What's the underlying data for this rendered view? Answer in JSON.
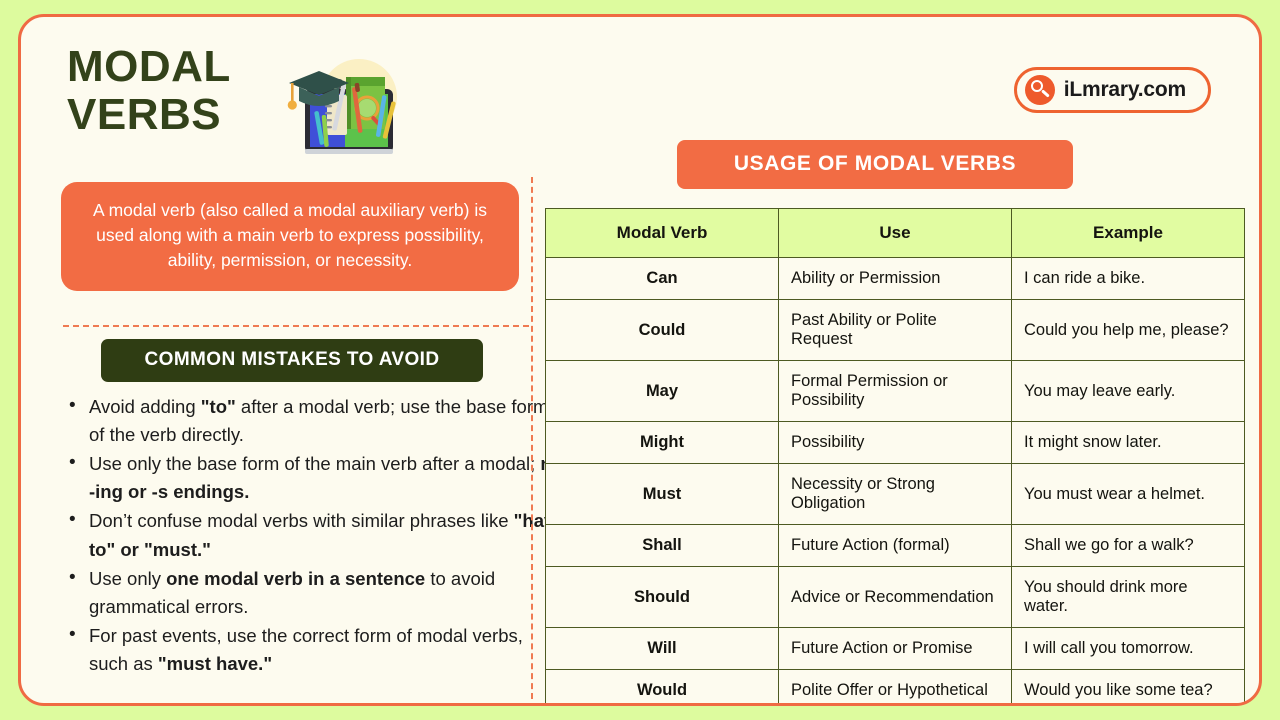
{
  "poster": {
    "title": "MODAL VERBS",
    "background_color": "#ddfb9e",
    "card_color": "#fdfbef",
    "accent_orange": "#f26c44",
    "accent_dark_green": "#2f3d13",
    "accent_lime": "#e1fca1"
  },
  "brand": {
    "name": "iLmrary.com",
    "icon": "magnifier-icon"
  },
  "definition": {
    "text": "A modal verb (also called a modal auxiliary verb) is used along with a main verb to express possibility, ability, permission, or necessity."
  },
  "mistakes": {
    "heading": "COMMON MISTAKES TO AVOID",
    "items": [
      {
        "parts": [
          {
            "text": "Avoid adding ",
            "bold": false
          },
          {
            "text": "\"to\"",
            "bold": true
          },
          {
            "text": " after a modal verb; use the base form of the verb directly.",
            "bold": false
          }
        ]
      },
      {
        "parts": [
          {
            "text": "Use only the base form of the main verb after a modal; ",
            "bold": false
          },
          {
            "text": "no -ing or -s endings.",
            "bold": true
          }
        ]
      },
      {
        "parts": [
          {
            "text": "Don’t confuse modal verbs with similar phrases like ",
            "bold": false
          },
          {
            "text": "\"have to\" or \"must.\"",
            "bold": true
          }
        ]
      },
      {
        "parts": [
          {
            "text": "Use only ",
            "bold": false
          },
          {
            "text": "one modal verb in a sentence",
            "bold": true
          },
          {
            "text": " to avoid grammatical errors.",
            "bold": false
          }
        ]
      },
      {
        "parts": [
          {
            "text": "For past events, use the correct form of modal verbs, such as ",
            "bold": false
          },
          {
            "text": "\"must have.\"",
            "bold": true
          }
        ]
      }
    ]
  },
  "usage": {
    "banner": "USAGE OF MODAL VERBS",
    "columns": [
      "Modal Verb",
      "Use",
      "Example"
    ],
    "rows": [
      [
        "Can",
        "Ability or Permission",
        "I can ride a bike."
      ],
      [
        "Could",
        "Past Ability or Polite Request",
        "Could you help me, please?"
      ],
      [
        "May",
        "Formal Permission or Possibility",
        "You may leave early."
      ],
      [
        "Might",
        "Possibility",
        "It might snow later."
      ],
      [
        "Must",
        "Necessity or Strong Obligation",
        "You must wear a helmet."
      ],
      [
        "Shall",
        "Future Action (formal)",
        "Shall we go for a walk?"
      ],
      [
        "Should",
        "Advice or Recommendation",
        "You should drink more water."
      ],
      [
        "Will",
        "Future Action or Promise",
        "I will call you tomorrow."
      ],
      [
        "Would",
        "Polite Offer or Hypothetical",
        "Would you like some tea?"
      ]
    ]
  }
}
